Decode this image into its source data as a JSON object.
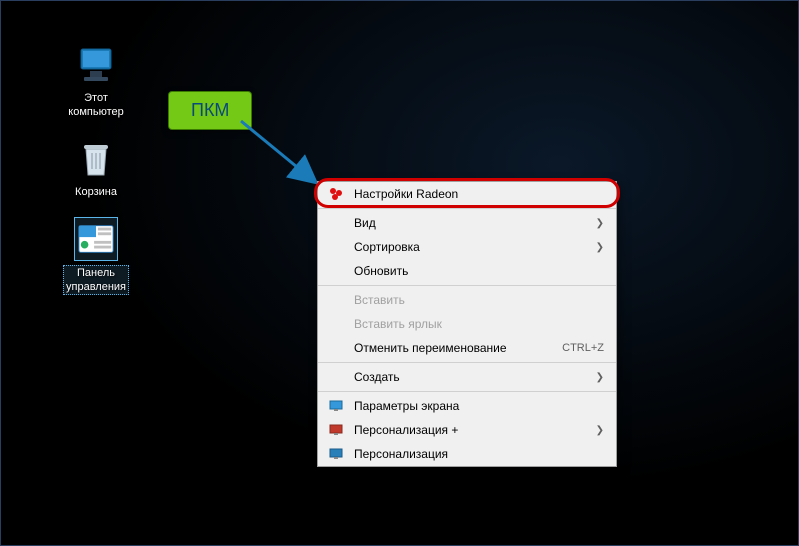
{
  "icons": {
    "this_pc": "Этот\nкомпьютер",
    "recycle": "Корзина",
    "control_panel": "Панель\nуправления"
  },
  "callout": {
    "text": "ПКМ"
  },
  "menu": {
    "radeon": "Настройки Radeon",
    "view": "Вид",
    "sort": "Сортировка",
    "refresh": "Обновить",
    "paste": "Вставить",
    "paste_shortcut": "Вставить ярлык",
    "undo_rename": "Отменить переименование",
    "undo_key": "CTRL+Z",
    "new": "Создать",
    "display": "Параметры экрана",
    "personalize_plus": "Персонализация +",
    "personalize": "Персонализация"
  }
}
